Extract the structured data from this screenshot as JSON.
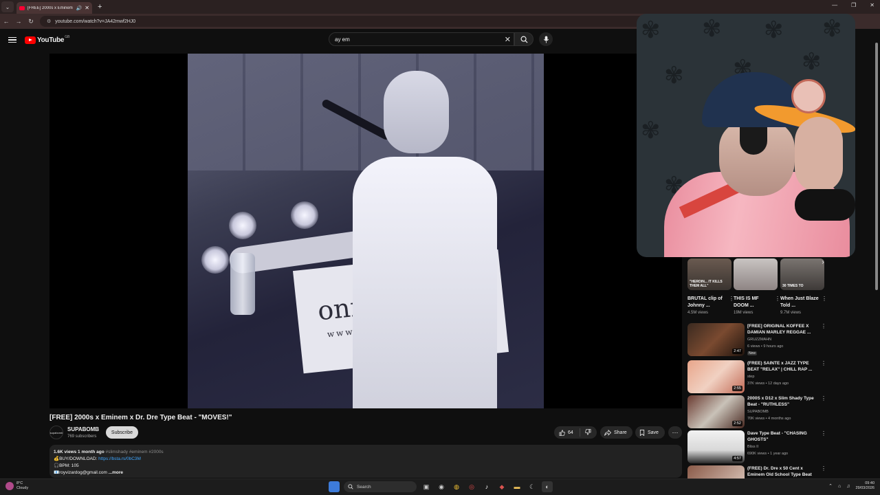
{
  "browser": {
    "tab_title": "[FREE] 2000s x Eminem x Dr",
    "url": "youtube.com/watch?v=JA42mwf2HJ0"
  },
  "youtube": {
    "logo_text": "YouTube",
    "region_code": "GB",
    "search_value": "ay em"
  },
  "video": {
    "title": "[FREE] 2000s x Eminem x Dr. Dre Type Beat - \"MOVES!\"",
    "channel": "SUPABOMB",
    "channel_avatar_text": "supabomb",
    "subscribers": "769 subscribers",
    "subscribe_label": "Subscribe",
    "likes": "64",
    "share_label": "Share",
    "save_label": "Save",
    "banner_text": "onra",
    "banner_web": "www.on",
    "description": {
      "stats": "1.6K views  1 month ago",
      "tags": "#slimshady #eminem #2000s",
      "buy_label": "💰BUY/DOWNLOAD: ",
      "buy_link": "https://bsta.rs/0bC3M",
      "bpm": "🎧BPM: 105",
      "email": "📧royvizardog@gmail.com",
      "more": "...more"
    }
  },
  "shorts": [
    {
      "overlay": "\"HEROIN... IT KILLS THEM ALL\"",
      "title": "BRUTAL clip of Johnny ...",
      "views": "4.5M views"
    },
    {
      "overlay": "",
      "title": "THIS IS MF DOOM ...",
      "views": "19M views"
    },
    {
      "overlay": "30 TIMES TO",
      "title": "When Just Blaze Told ...",
      "views": "9.7M views"
    }
  ],
  "recommendations": [
    {
      "title": "[FREE] ORIGINAL KOFFEE X DAMIAN MARLEY REGGAE ...",
      "channel": "GRUZZMAHN",
      "meta": "6 views • 9 hours ago",
      "badge": "New",
      "duration": "2:47"
    },
    {
      "title": "(FREE) SAINTE x JAZZ TYPE BEAT \"RELAX\" | CHILL RAP ...",
      "channel": "step",
      "meta": "37K views • 12 days ago",
      "badge": "",
      "duration": "2:55"
    },
    {
      "title": "2000S x D12 x Slim Shady Type Beat - \"RUTHLESS\"",
      "channel": "SUPABOMB",
      "meta": "70K views • 4 months ago",
      "badge": "",
      "duration": "2:52"
    },
    {
      "title": "Dave Type Beat - \"CHASING GHOSTS\"",
      "channel": "Bliss II",
      "meta": "690K views • 1 year ago",
      "badge": "",
      "duration": "4:57"
    },
    {
      "title": "(FREE) Dr. Dre x 50 Cent x Eminem Old School Type Beat ...",
      "channel": "",
      "meta": "",
      "badge": "",
      "duration": ""
    }
  ],
  "taskbar": {
    "weather_temp": "8°C",
    "weather_desc": "Cloudy",
    "search_label": "Search",
    "time": "09:40",
    "date": "29/03/2026"
  },
  "colors": {
    "background": "#0f0f0f",
    "youtube_red": "#ff0000",
    "link": "#3ea6ff"
  }
}
